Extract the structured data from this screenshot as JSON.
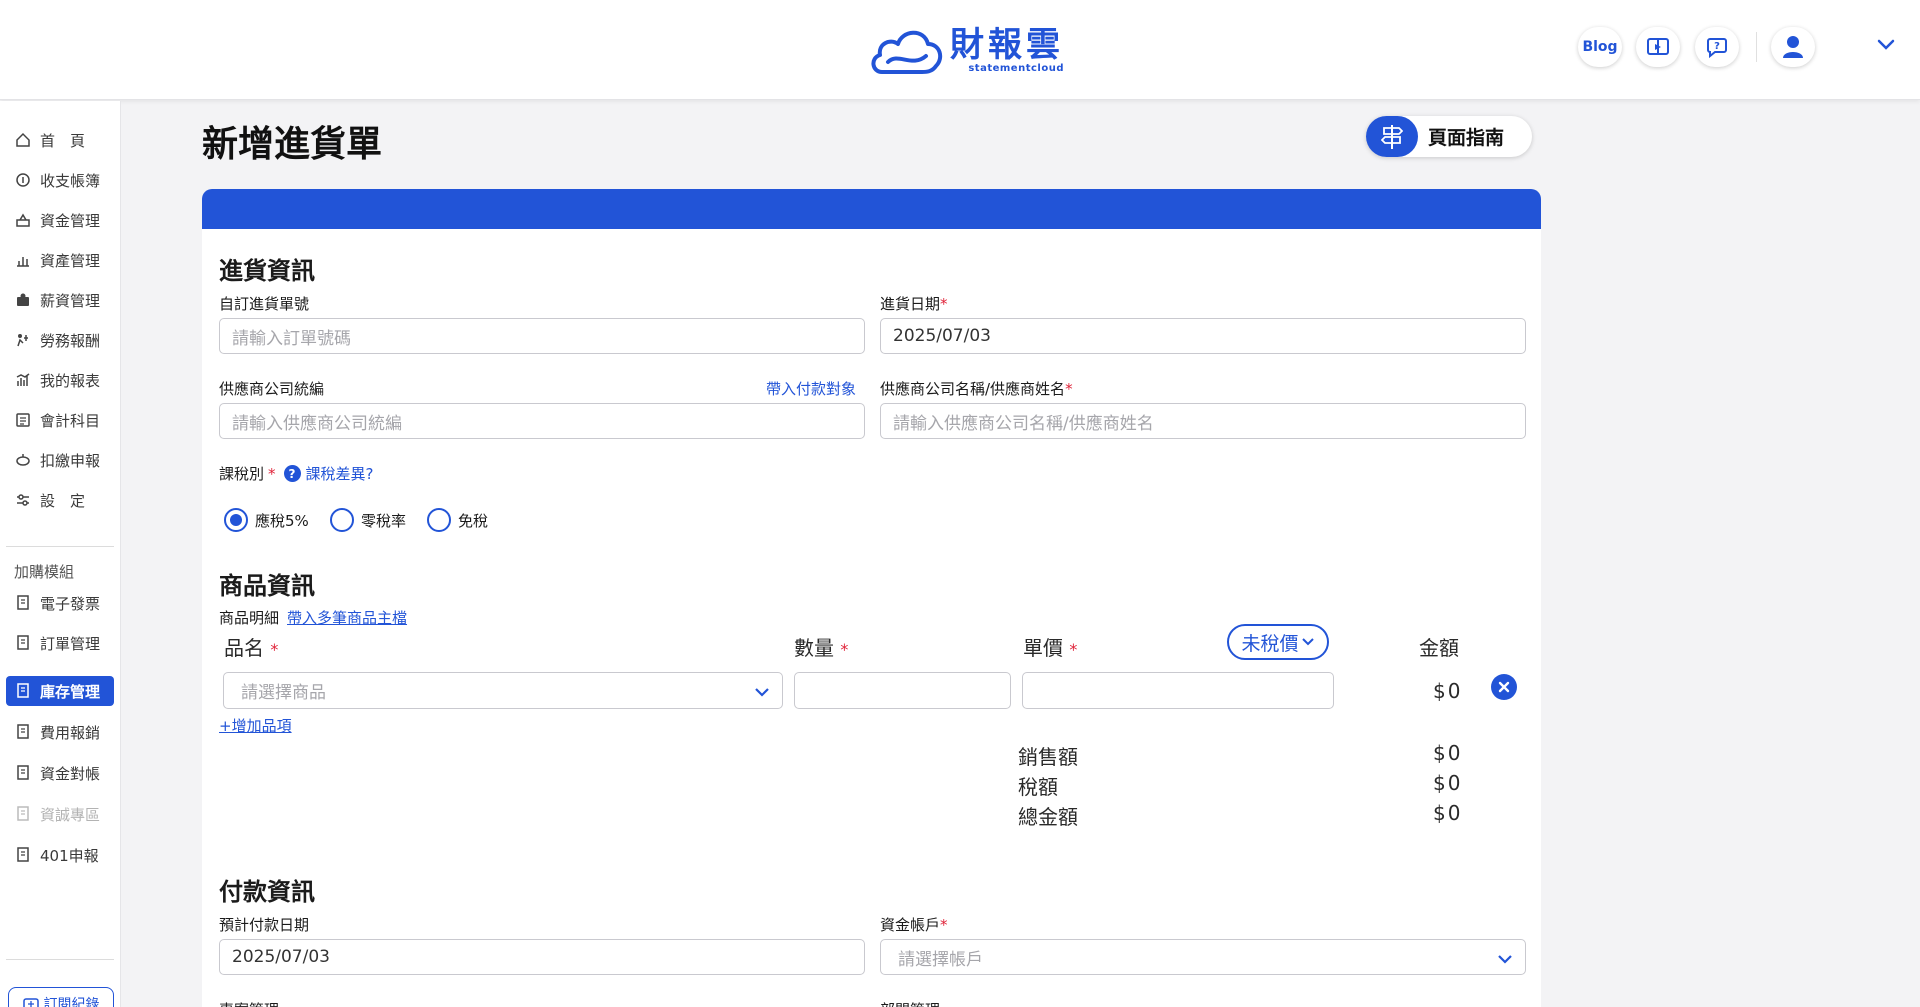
{
  "header": {
    "logo_name": "財報雲",
    "logo_sub": "statementcloud",
    "blog_label": "Blog",
    "colors": {
      "brand": "#2254d7"
    }
  },
  "sidebar": {
    "items": [
      {
        "label": "首　頁",
        "icon": "home-icon"
      },
      {
        "label": "收支帳簿",
        "icon": "ledger-icon"
      },
      {
        "label": "資金管理",
        "icon": "fund-icon"
      },
      {
        "label": "資產管理",
        "icon": "asset-icon"
      },
      {
        "label": "薪資管理",
        "icon": "salary-icon"
      },
      {
        "label": "勞務報酬",
        "icon": "labor-icon"
      },
      {
        "label": "我的報表",
        "icon": "report-icon"
      },
      {
        "label": "會計科目",
        "icon": "account-icon"
      },
      {
        "label": "扣繳申報",
        "icon": "withholding-icon"
      },
      {
        "label": "設　定",
        "icon": "settings-icon"
      }
    ],
    "group_label": "加購模組",
    "modules": [
      {
        "label": "電子發票",
        "icon": "module-icon"
      },
      {
        "label": "訂單管理",
        "icon": "module-icon"
      },
      {
        "label": "庫存管理",
        "icon": "module-icon",
        "active": true
      },
      {
        "label": "費用報銷",
        "icon": "module-icon"
      },
      {
        "label": "資金對帳",
        "icon": "module-icon"
      },
      {
        "label": "資誠專區",
        "icon": "module-icon",
        "disabled": true
      },
      {
        "label": "401申報",
        "icon": "module-icon"
      }
    ],
    "subscription_label": "訂閱紀錄"
  },
  "page": {
    "title": "新增進貨單",
    "guide_label": "頁面指南"
  },
  "purchase_info": {
    "section_title": "進貨資訊",
    "order_no_label": "自訂進貨單號",
    "order_no_placeholder": "請輸入訂單號碼",
    "date_label": "進貨日期",
    "date_value": "2025/07/03",
    "supplier_id_label": "供應商公司統編",
    "import_payee_link": "帶入付款對象",
    "supplier_id_placeholder": "請輸入供應商公司統編",
    "supplier_name_label": "供應商公司名稱/供應商姓名",
    "supplier_name_placeholder": "請輸入供應商公司名稱/供應商姓名",
    "tax_type_label": "課稅別",
    "tax_diff_link": "課稅差異?",
    "tax_options": [
      "應稅5%",
      "零稅率",
      "免稅"
    ],
    "tax_selected": "應稅5%"
  },
  "product_info": {
    "section_title": "商品資訊",
    "detail_label": "商品明細",
    "import_products_link": "帶入多筆商品主檔",
    "col_name": "品名",
    "col_qty": "數量",
    "col_price": "單價",
    "price_mode": "未稅價",
    "col_amount": "金額",
    "product_placeholder": "請選擇商品",
    "row_amount": "$0",
    "add_item_link": "+增加品項",
    "sales_label": "銷售額",
    "sales_value": "$0",
    "tax_label": "稅額",
    "tax_value": "$0",
    "total_label": "總金額",
    "total_value": "$0"
  },
  "payment_info": {
    "section_title": "付款資訊",
    "due_date_label": "預計付款日期",
    "due_date_value": "2025/07/03",
    "account_label": "資金帳戶",
    "account_placeholder": "請選擇帳戶",
    "project_label": "專案管理",
    "dept_label": "部門管理"
  }
}
